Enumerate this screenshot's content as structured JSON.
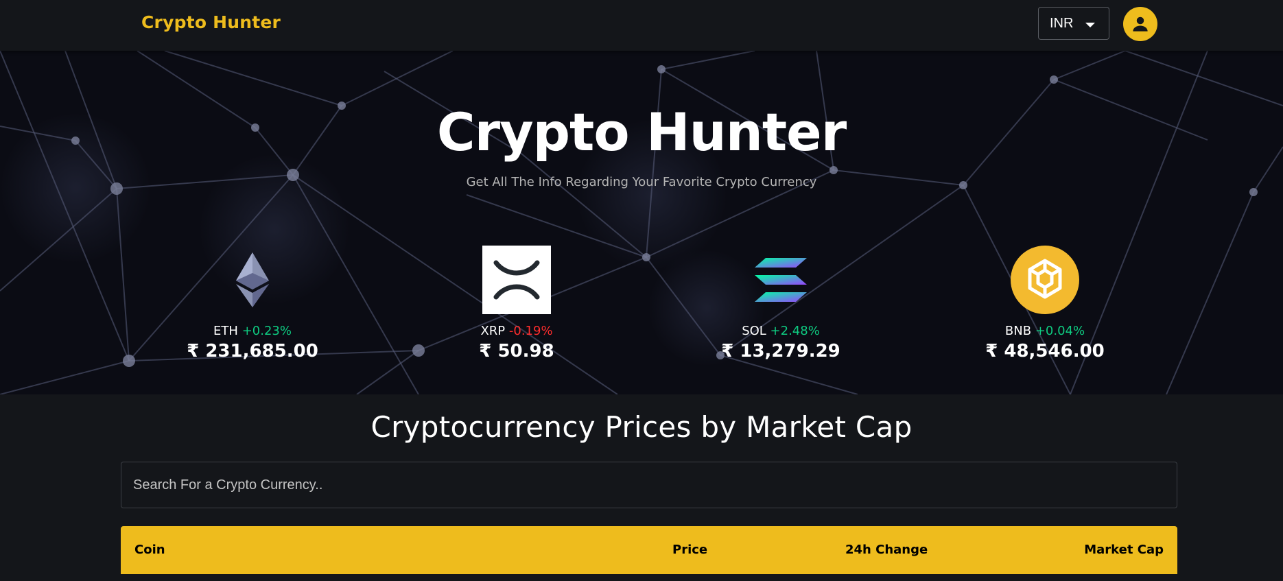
{
  "nav": {
    "brand": "Crypto Hunter",
    "currency": "INR",
    "user_icon": "account-icon"
  },
  "colors": {
    "accent": "#eebc1d",
    "background": "#14161a",
    "positive": "#0ecb81",
    "negative": "#ff2d2d"
  },
  "hero": {
    "title": "Crypto Hunter",
    "subtitle": "Get All The Info Regarding Your Favorite Crypto Currency"
  },
  "carousel": [
    {
      "symbol": "ETH",
      "change": "+0.23%",
      "price": "₹ 231,685.00",
      "icon": "ethereum-icon"
    },
    {
      "symbol": "XRP",
      "change": "-0.19%",
      "price": "₹ 50.98",
      "icon": "xrp-icon"
    },
    {
      "symbol": "SOL",
      "change": "+2.48%",
      "price": "₹ 13,279.29",
      "icon": "solana-icon"
    },
    {
      "symbol": "BNB",
      "change": "+0.04%",
      "price": "₹ 48,546.00",
      "icon": "bnb-icon"
    }
  ],
  "section": {
    "title": "Cryptocurrency Prices by Market Cap",
    "search_placeholder": "Search For a Crypto Currency.."
  },
  "table": {
    "headers": [
      "Coin",
      "Price",
      "24h Change",
      "Market Cap"
    ]
  }
}
